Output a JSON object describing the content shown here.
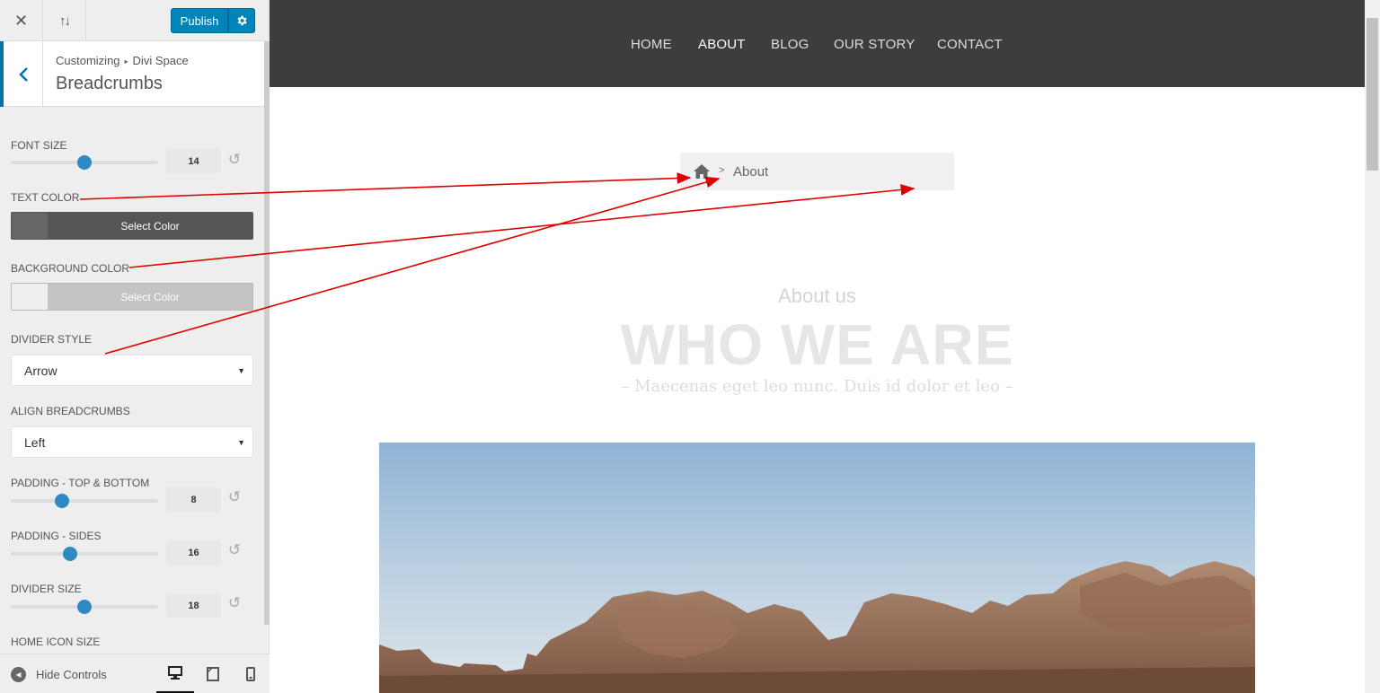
{
  "topbar": {
    "close_icon": "close-icon",
    "reorder_icon": "sort-arrows-icon",
    "publish_label": "Publish",
    "settings_icon": "gear-icon",
    "accent_color": "#0085ba"
  },
  "section": {
    "breadcrumb_root": "Customizing",
    "breadcrumb_parent": "Divi Space",
    "title": "Breadcrumbs"
  },
  "controls": {
    "font_size": {
      "label": "FONT SIZE",
      "value": "14",
      "fraction": 0.5
    },
    "text_color": {
      "label": "TEXT COLOR",
      "button": "Select Color",
      "color": "#555555"
    },
    "background_color": {
      "label": "BACKGROUND COLOR",
      "button": "Select Color",
      "color": "#c4c4c4"
    },
    "divider_style": {
      "label": "DIVIDER STYLE",
      "value": "Arrow"
    },
    "align": {
      "label": "ALIGN BREADCRUMBS",
      "value": "Left"
    },
    "padding_tb": {
      "label": "PADDING - TOP & BOTTOM",
      "value": "8",
      "fraction": 0.35
    },
    "padding_sides": {
      "label": "PADDING - SIDES",
      "value": "16",
      "fraction": 0.4
    },
    "divider_size": {
      "label": "DIVIDER SIZE",
      "value": "18",
      "fraction": 0.5
    },
    "home_icon_size": {
      "label": "HOME ICON SIZE"
    }
  },
  "bottombar": {
    "hide_label": "Hide Controls",
    "devices": [
      "desktop-icon",
      "tablet-icon",
      "mobile-icon"
    ]
  },
  "preview": {
    "nav": [
      "HOME",
      "ABOUT",
      "BLOG",
      "OUR STORY",
      "CONTACT"
    ],
    "active_nav": "ABOUT",
    "breadcrumb": {
      "home_icon": "home-icon",
      "divider": ">",
      "current": "About"
    },
    "about_us": "About us",
    "heading": "WHO WE ARE",
    "tagline": "– Maecenas eget leo nunc. Duis id dolor et leo –"
  }
}
